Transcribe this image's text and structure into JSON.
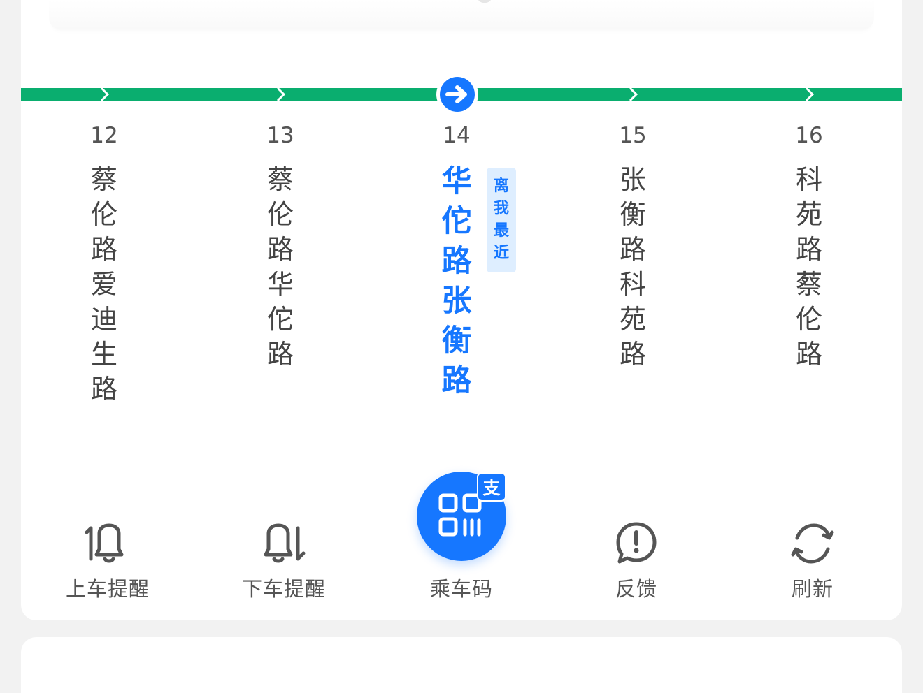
{
  "colors": {
    "route_line": "#0aae6f",
    "accent": "#1677ff",
    "text_primary": "#444444",
    "text_secondary": "#555555",
    "background": "#f2f2f2"
  },
  "stops": [
    {
      "number": "12",
      "name": "蔡伦路爱迪生路",
      "current": false
    },
    {
      "number": "13",
      "name": "蔡伦路华佗路",
      "current": false
    },
    {
      "number": "14",
      "name": "华佗路张衡路",
      "current": true
    },
    {
      "number": "15",
      "name": "张衡路科苑路",
      "current": false
    },
    {
      "number": "16",
      "name": "科苑路蔡伦路",
      "current": false
    }
  ],
  "nearest_tag": "离我最近",
  "current_marker_icon": "arrow-right-icon",
  "actions": {
    "board_reminder": {
      "label": "上车提醒",
      "icon": "bell-boarding-icon"
    },
    "alight_reminder": {
      "label": "下车提醒",
      "icon": "bell-alighting-icon"
    },
    "ride_code": {
      "label": "乘车码",
      "icon": "qr-code-icon",
      "badge": "支"
    },
    "feedback": {
      "label": "反馈",
      "icon": "feedback-icon"
    },
    "refresh": {
      "label": "刷新",
      "icon": "refresh-icon"
    }
  }
}
